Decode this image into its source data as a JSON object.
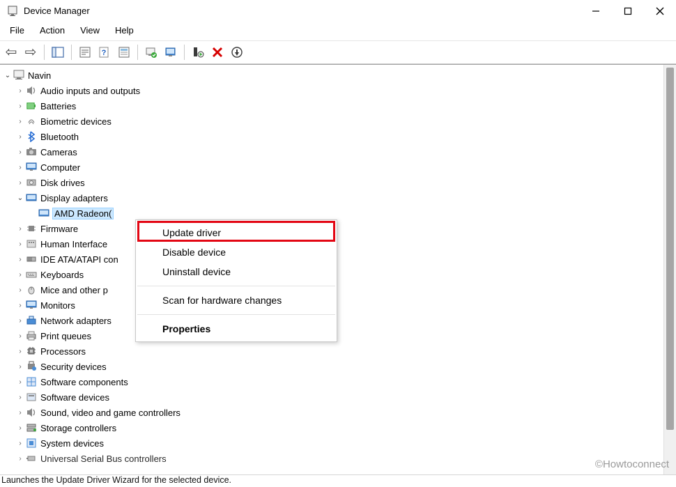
{
  "window": {
    "title": "Device Manager"
  },
  "menu": {
    "file": "File",
    "action": "Action",
    "view": "View",
    "help": "Help"
  },
  "tree": {
    "root": "Navin",
    "categories": [
      "Audio inputs and outputs",
      "Batteries",
      "Biometric devices",
      "Bluetooth",
      "Cameras",
      "Computer",
      "Disk drives",
      "Display adapters",
      "Firmware",
      "Human Interface Devices",
      "IDE ATA/ATAPI controllers",
      "Keyboards",
      "Mice and other pointing devices",
      "Monitors",
      "Network adapters",
      "Print queues",
      "Processors",
      "Security devices",
      "Software components",
      "Software devices",
      "Sound, video and game controllers",
      "Storage controllers",
      "System devices",
      "Universal Serial Bus controllers"
    ],
    "truncated": {
      "human_interface": "Human Interface ",
      "ide": "IDE ATA/ATAPI con",
      "mice": "Mice and other p"
    },
    "display_adapters_child": "AMD Radeon(TM) Graphics",
    "display_adapters_child_truncated": "AMD Radeon("
  },
  "context_menu": {
    "update_driver": "Update driver",
    "disable_device": "Disable device",
    "uninstall_device": "Uninstall device",
    "scan_hardware": "Scan for hardware changes",
    "properties": "Properties"
  },
  "statusbar": {
    "text": "Launches the Update Driver Wizard for the selected device."
  },
  "watermark": "©Howtoconnect"
}
